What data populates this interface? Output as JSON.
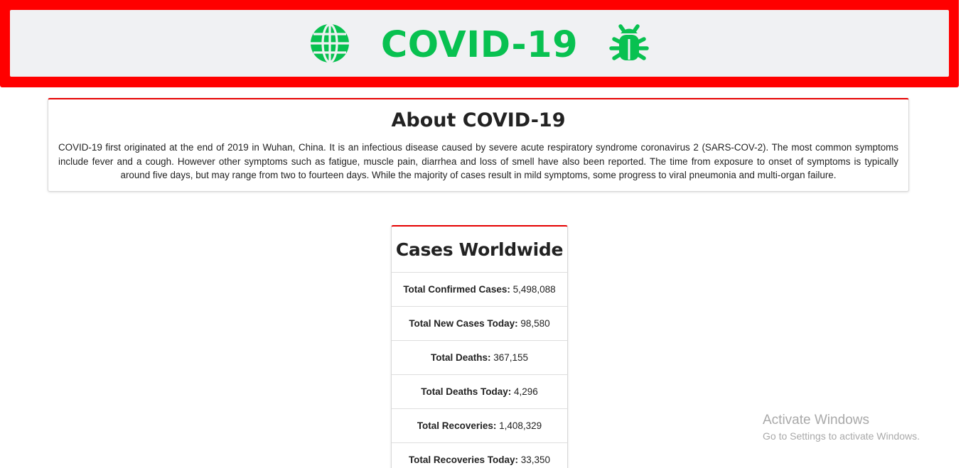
{
  "header": {
    "title": "COVID-19",
    "left_icon": "globe-icon",
    "right_icon": "bug-icon",
    "accent_color": "#08c150",
    "border_color": "#ff0000"
  },
  "about": {
    "title": "About COVID-19",
    "text": "COVID-19 first originated at the end of 2019 in Wuhan, China. It is an infectious disease caused by severe acute respiratory syndrome coronavirus 2 (SARS-COV-2). The most common symptoms include fever and a cough. However other symptoms such as fatigue, muscle pain, diarrhea and loss of smell have also been reported. The time from exposure to onset of symptoms is typically around five days, but may range from two to fourteen days. While the majority of cases result in mild symptoms, some progress to viral pneumonia and multi-organ failure."
  },
  "cases": {
    "title": "Cases Worldwide",
    "stats": [
      {
        "label": "Total Confirmed Cases:",
        "value": "5,498,088"
      },
      {
        "label": "Total New Cases Today:",
        "value": "98,580"
      },
      {
        "label": "Total Deaths:",
        "value": "367,155"
      },
      {
        "label": "Total Deaths Today:",
        "value": "4,296"
      },
      {
        "label": "Total Recoveries:",
        "value": "1,408,329"
      },
      {
        "label": "Total Recoveries Today:",
        "value": "33,350"
      }
    ]
  },
  "watermark": {
    "title": "Activate Windows",
    "subtitle": "Go to Settings to activate Windows."
  }
}
